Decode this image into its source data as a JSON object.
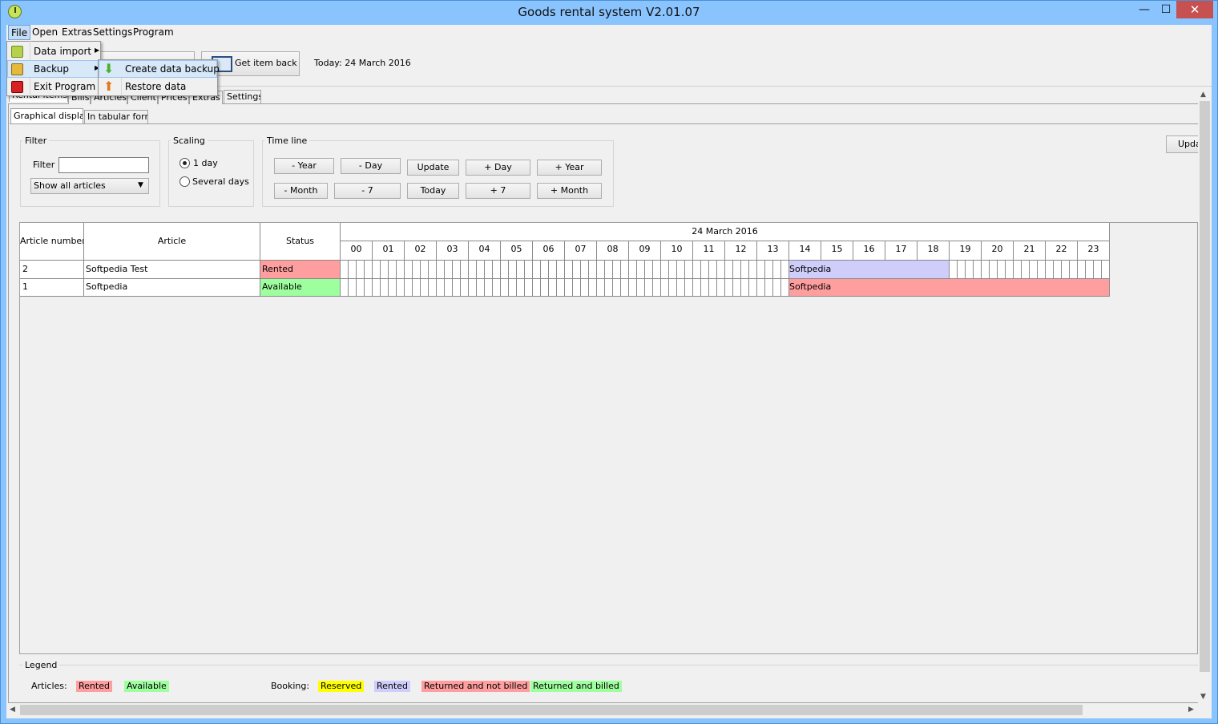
{
  "window": {
    "title": "Goods rental system V2.01.07",
    "minimize": "—",
    "maximize": "☐",
    "close": "✕"
  },
  "menubar": {
    "file": "File",
    "open": "Open",
    "extras": "Extras",
    "settings": "Settings",
    "program": "Program"
  },
  "file_menu": {
    "data_import": "Data import",
    "backup": "Backup",
    "exit": "Exit Program"
  },
  "backup_menu": {
    "create": "Create data backup",
    "restore": "Restore data"
  },
  "toolbar": {
    "get_item_back": "Get item back",
    "today": "Today: 24 March 2016"
  },
  "tabs": {
    "rental": "Rental items",
    "bills": "Bills",
    "articles": "Articles",
    "client": "Client",
    "prices": "Prices",
    "extras": "Extras",
    "settings": "Settings"
  },
  "subtabs": {
    "graphical": "Graphical display",
    "tabular": "In tabular form"
  },
  "filter": {
    "group": "Filter",
    "label": "Filter",
    "value": "",
    "select": "Show all articles"
  },
  "scaling": {
    "group": "Scaling",
    "one_day": "1 day",
    "several_days": "Several days",
    "selected": "1 day"
  },
  "timeline": {
    "group": "Time line",
    "minus_year": "- Year",
    "minus_day": "- Day",
    "update": "Update",
    "plus_day": "+ Day",
    "plus_year": "+ Year",
    "minus_month": "- Month",
    "minus_7": "- 7",
    "today": "Today",
    "plus_7": "+ 7",
    "plus_month": "+ Month"
  },
  "update_right": "Upda",
  "grid": {
    "columns": {
      "article_number": "Article number",
      "article": "Article",
      "status": "Status"
    },
    "date": "24 March 2016",
    "hours": [
      "00",
      "01",
      "02",
      "03",
      "04",
      "05",
      "06",
      "07",
      "08",
      "09",
      "10",
      "11",
      "12",
      "13",
      "14",
      "15",
      "16",
      "17",
      "18",
      "19",
      "20",
      "21",
      "22",
      "23"
    ],
    "rows": [
      {
        "number": "2",
        "article": "Softpedia Test",
        "status": "Rented",
        "status_color": "#ff9e9e",
        "booking": "Softpedia",
        "booking_color": "#cfcdfa",
        "booking_from_hour": 14,
        "booking_to_hour": 19
      },
      {
        "number": "1",
        "article": "Softpedia",
        "status": "Available",
        "status_color": "#9eff9e",
        "booking": "Softpedia",
        "booking_color": "#ff9e9e",
        "booking_from_hour": 14,
        "booking_to_hour": 24
      }
    ]
  },
  "legend": {
    "title": "Legend",
    "articles_label": "Articles:",
    "booking_label": "Booking:",
    "articles": [
      {
        "label": "Rented",
        "color": "#ff9e9e"
      },
      {
        "label": "Available",
        "color": "#9eff9e"
      }
    ],
    "booking": [
      {
        "label": "Reserved",
        "color": "#ffff00"
      },
      {
        "label": "Rented",
        "color": "#cfcdfa"
      },
      {
        "label": "Returned and not billed",
        "color": "#ff9e9e"
      },
      {
        "label": "Returned and billed",
        "color": "#9eff9e"
      }
    ]
  }
}
